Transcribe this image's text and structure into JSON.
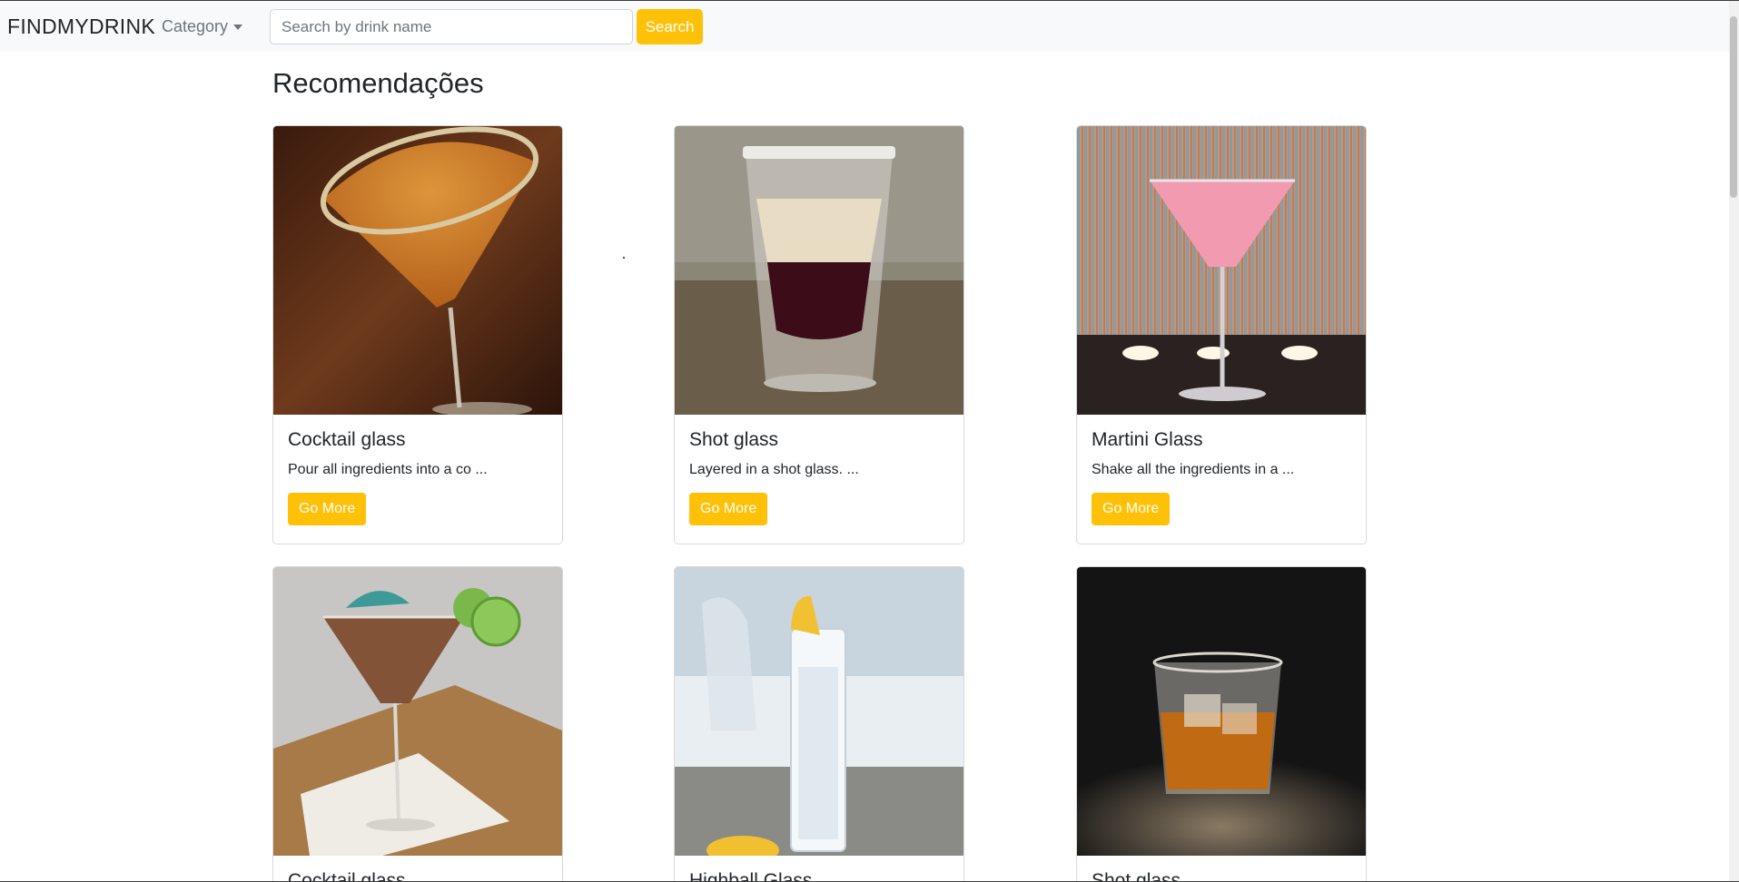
{
  "navbar": {
    "brand": "FINDMYDRINK",
    "category_label": "Category",
    "search_placeholder": "Search by drink name",
    "search_button": "Search"
  },
  "page": {
    "title": "Recomendações"
  },
  "cards": [
    {
      "title": "Cocktail glass",
      "text": "Pour all ingredients into a co ...",
      "button": "Go More",
      "image": "orange-martini-photo"
    },
    {
      "title": "Shot glass",
      "text": "Layered in a shot glass. ...",
      "button": "Go More",
      "image": "layered-shot-photo"
    },
    {
      "title": "Martini Glass",
      "text": "Shake all the ingredients in a ...",
      "button": "Go More",
      "image": "pink-martini-photo"
    },
    {
      "title": "Cocktail glass",
      "image": "umbrella-martini-photo"
    },
    {
      "title": "Highball Glass",
      "image": "highball-lemon-photo"
    },
    {
      "title": "Shot glass",
      "image": "whiskey-rocks-photo"
    }
  ],
  "colors": {
    "accent": "#ffc107",
    "navbar_bg": "#f8f9fa",
    "text": "#212529"
  }
}
